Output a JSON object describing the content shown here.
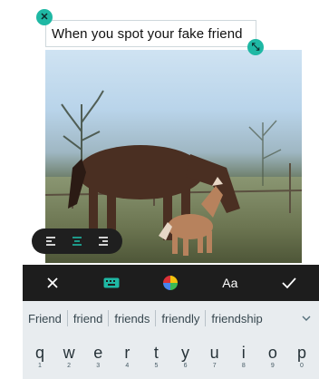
{
  "caption": {
    "text": "When you spot your fake friend"
  },
  "alignment": {
    "options": [
      "align-left",
      "align-center",
      "align-right"
    ],
    "selected": "align-center"
  },
  "toolbar": {
    "close_icon": "close-icon",
    "keyboard_icon": "keyboard-icon",
    "color_icon": "color-palette-icon",
    "font_label": "Aa",
    "confirm_icon": "check-icon"
  },
  "suggestions": [
    "Friend",
    "friend",
    "friends",
    "friendly",
    "friendship"
  ],
  "keyboard": {
    "keys": [
      {
        "ch": "q",
        "num": "1"
      },
      {
        "ch": "w",
        "num": "2"
      },
      {
        "ch": "e",
        "num": "3"
      },
      {
        "ch": "r",
        "num": "4"
      },
      {
        "ch": "t",
        "num": "5"
      },
      {
        "ch": "y",
        "num": "6"
      },
      {
        "ch": "u",
        "num": "7"
      },
      {
        "ch": "i",
        "num": "8"
      },
      {
        "ch": "o",
        "num": "9"
      },
      {
        "ch": "p",
        "num": "0"
      }
    ]
  },
  "colors": {
    "accent": "#1fb8a4",
    "toolbar_bg": "#1d1d1d",
    "keyboard_bg": "#e8ecef"
  }
}
